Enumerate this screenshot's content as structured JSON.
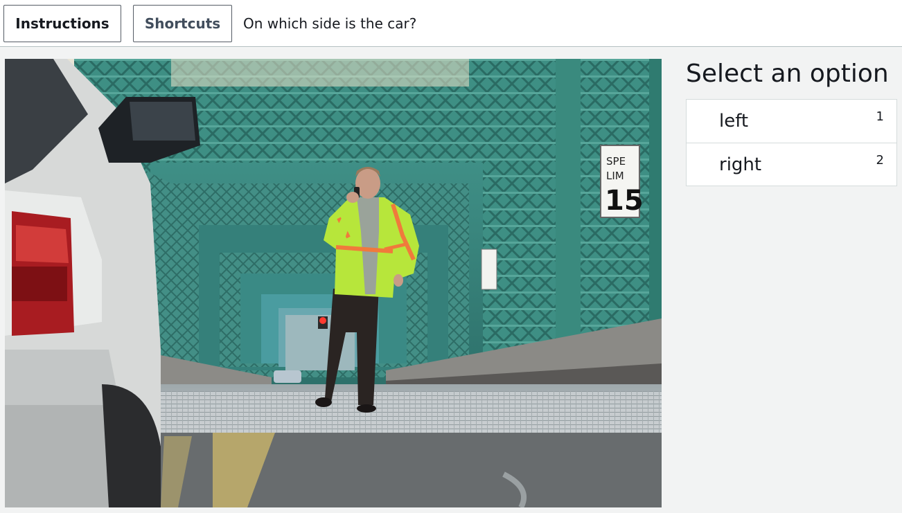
{
  "toolbar": {
    "instructions_label": "Instructions",
    "shortcuts_label": "Shortcuts",
    "question": "On which side is the car?"
  },
  "photo": {
    "sign_speed_text_1": "SPE",
    "sign_speed_text_2": "LIM",
    "sign_speed_value": "15"
  },
  "panel": {
    "title": "Select an option",
    "options": [
      {
        "label": "left",
        "hotkey": "1"
      },
      {
        "label": "right",
        "hotkey": "2"
      }
    ]
  }
}
